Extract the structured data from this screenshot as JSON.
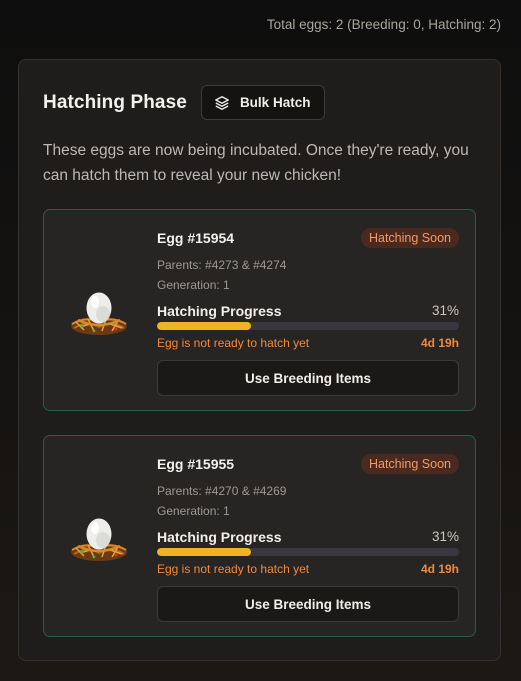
{
  "header": {
    "totals": "Total eggs: 2 (Breeding: 0, Hatching: 2)"
  },
  "panel": {
    "title": "Hatching Phase",
    "bulk_button": {
      "label": "Bulk Hatch",
      "icon": "layers-icon"
    },
    "description": "These eggs are now being incubated. Once they're ready, you can hatch them to reveal your new chicken!"
  },
  "eggs": [
    {
      "name": "Egg #15954",
      "badge": "Hatching Soon",
      "parents": "Parents: #4273 & #4274",
      "generation": "Generation: 1",
      "progress_label": "Hatching Progress",
      "progress_text": "31%",
      "progress": 0.31,
      "status": "Egg is not ready to hatch yet",
      "time_left": "4d 19h",
      "button": "Use Breeding Items"
    },
    {
      "name": "Egg #15955",
      "badge": "Hatching Soon",
      "parents": "Parents: #4270 & #4269",
      "generation": "Generation: 1",
      "progress_label": "Hatching Progress",
      "progress_text": "31%",
      "progress": 0.31,
      "status": "Egg is not ready to hatch yet",
      "time_left": "4d 19h",
      "button": "Use Breeding Items"
    }
  ],
  "colors": {
    "accent_progress": "#f0b323",
    "badge_text": "#f09a6b",
    "warning_text": "#ef8a3a",
    "card_border": "#2e5a45"
  }
}
